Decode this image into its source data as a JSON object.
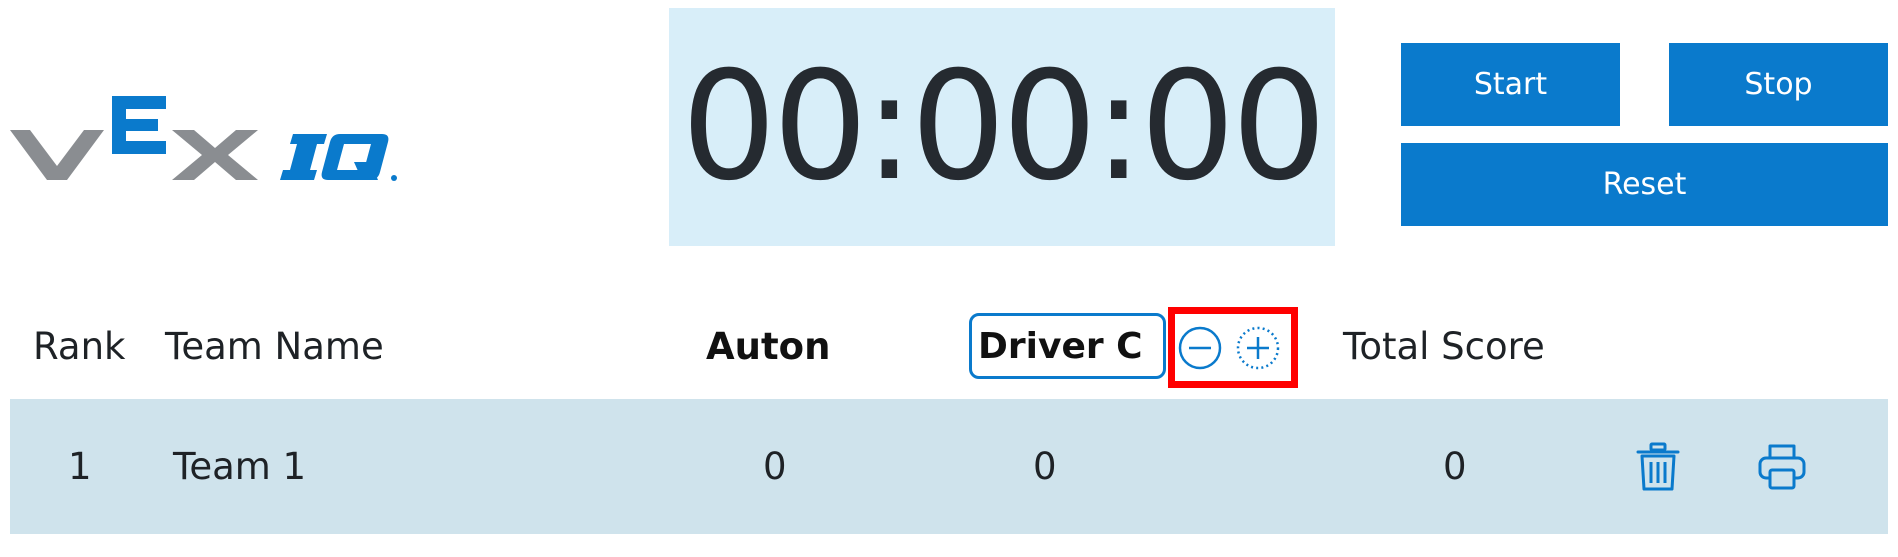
{
  "logo": {
    "brand": "VEX",
    "product": "IQ",
    "colors": {
      "gray": "#8a8d91",
      "blue": "#0a7acc"
    }
  },
  "timer": {
    "display": "00:00:00"
  },
  "controls": {
    "start_label": "Start",
    "stop_label": "Stop",
    "reset_label": "Reset"
  },
  "table": {
    "headers": {
      "rank": "Rank",
      "team_name": "Team Name",
      "auton": "Auton",
      "driver": "Driver C",
      "total_score": "Total Score"
    },
    "rows": [
      {
        "rank": "1",
        "team_name": "Team 1",
        "auton": "0",
        "driver": "0",
        "total_score": "0"
      }
    ]
  },
  "icons": {
    "decrease": "minus-circle-icon",
    "increase": "plus-circle-icon",
    "delete": "trash-icon",
    "print": "printer-icon"
  },
  "colors": {
    "accent": "#0a7acc",
    "timer_bg": "#d8eef9",
    "row_bg": "#cfe3ec",
    "highlight": "#ff0000"
  }
}
